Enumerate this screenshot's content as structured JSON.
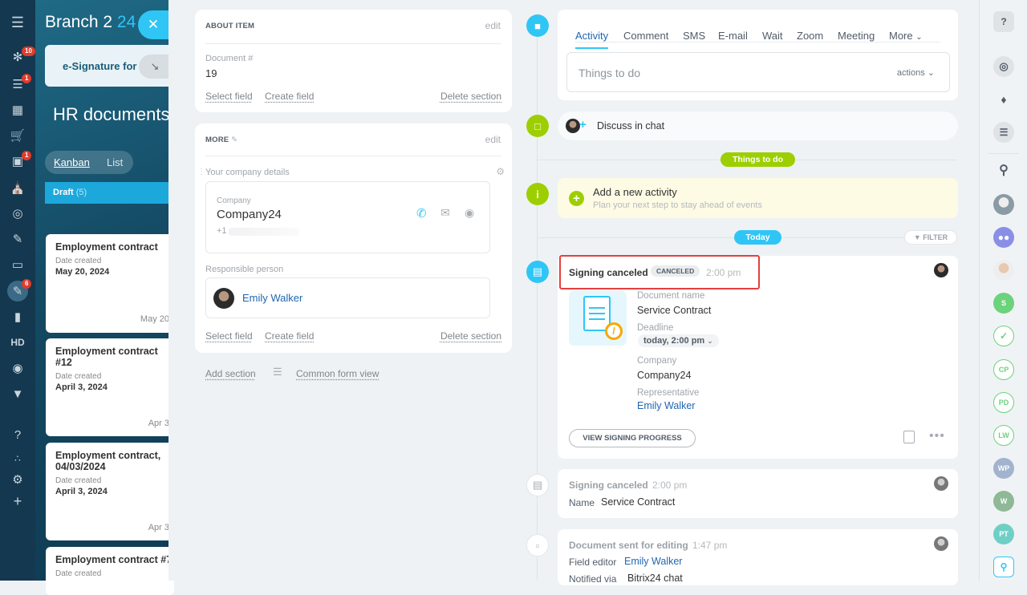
{
  "app": {
    "title_prefix": "Branch 2",
    "title_num": "24"
  },
  "leftnav": {
    "badges": {
      "feed": "10",
      "tasks": "1",
      "sites": "1",
      "sign": "6"
    },
    "hd_label": "HD"
  },
  "background": {
    "tab_label": "e-Signature for HR",
    "page_title": "HR documents",
    "views": [
      "Kanban",
      "List"
    ],
    "column": {
      "name": "Draft",
      "count": "(5)"
    },
    "cards": [
      {
        "title": "Employment contract",
        "date_label": "Date created",
        "date": "May 20, 2024",
        "right": "May 20"
      },
      {
        "title": "Employment contract #12",
        "date_label": "Date created",
        "date": "April 3, 2024",
        "right": "Apr 3"
      },
      {
        "title": "Employment contract,\n04/03/2024",
        "date_label": "Date created",
        "date": "April 3, 2024",
        "right": "Apr 3"
      },
      {
        "title": "Employment contract #7",
        "date_label": "Date created",
        "date": "",
        "right": ""
      }
    ]
  },
  "about": {
    "header": "ABOUT ITEM",
    "edit": "edit",
    "field_label": "Document #",
    "field_value": "19",
    "select_field": "Select field",
    "create_field": "Create field",
    "delete_section": "Delete section"
  },
  "more": {
    "header": "MORE",
    "edit": "edit",
    "company_details": "Your company details",
    "company_label": "Company",
    "company_name": "Company24",
    "phone": "+1",
    "responsible_label": "Responsible person",
    "responsible_name": "Emily Walker",
    "select_field": "Select field",
    "create_field": "Create field",
    "delete_section": "Delete section"
  },
  "footer_links": {
    "add_section": "Add section",
    "common_form": "Common form view"
  },
  "activity": {
    "tabs": [
      "Activity",
      "Comment",
      "SMS",
      "E-mail",
      "Wait",
      "Zoom",
      "Meeting",
      "More"
    ],
    "placeholder": "Things to do",
    "actions": "actions"
  },
  "chat": {
    "label": "Discuss in chat"
  },
  "things_pill": "Things to do",
  "new_activity": {
    "title": "Add a new activity",
    "subtitle": "Plan your next step to stay ahead of events"
  },
  "today_pill": "Today",
  "filter": "FILTER",
  "signing": {
    "title": "Signing canceled",
    "badge": "CANCELED",
    "time": "2:00 pm",
    "doc_label": "Document name",
    "doc_value": "Service Contract",
    "deadline_label": "Deadline",
    "deadline_value": "today, 2:00 pm",
    "company_label": "Company",
    "company_value": "Company24",
    "rep_label": "Representative",
    "rep_value": "Emily Walker",
    "button": "VIEW SIGNING PROGRESS"
  },
  "log1": {
    "title": "Signing canceled",
    "time": "2:00 pm",
    "name_label": "Name",
    "name_value": "Service Contract"
  },
  "log2": {
    "title": "Document sent for editing",
    "time": "1:47 pm",
    "editor_label": "Field editor",
    "editor_value": "Emily Walker",
    "notified_label": "Notified via",
    "notified_value": "Bitrix24 chat"
  },
  "rightbar": {
    "initials": [
      "S",
      "CP",
      "PD",
      "LW",
      "WP",
      "W",
      "PT"
    ]
  },
  "colors": {
    "accent": "#2fc6f6",
    "green": "#9dcf00",
    "link": "#2067b0",
    "highlight": "#e4403d"
  }
}
